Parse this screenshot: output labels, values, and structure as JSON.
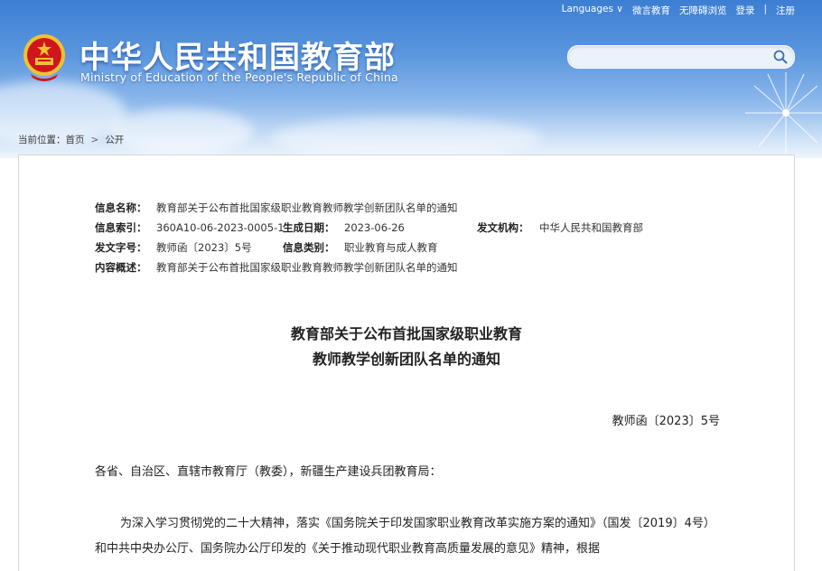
{
  "header": {
    "title_cn": "中华人民共和国教育部",
    "title_en": "Ministry of Education of the People's Republic of China",
    "top_links": {
      "languages": "Languages ∨",
      "weibo": "微言教育",
      "accessibility": "无障碍浏览",
      "login": "登录",
      "divider": "|",
      "register": "注册"
    },
    "search_placeholder": ""
  },
  "breadcrumb": {
    "prefix": "当前位置：",
    "home": "首页",
    "separator": ">",
    "current": "公开"
  },
  "meta": {
    "name_label": "信息名称：",
    "name_value": "教育部关于公布首批国家级职业教育教师教学创新团队名单的通知",
    "index_label": "信息索引：",
    "index_value": "360A10-06-2023-0005-1",
    "date_label": "生成日期：",
    "date_value": "2023-06-26",
    "org_label": "发文机构：",
    "org_value": "中华人民共和国教育部",
    "docno_label": "发文字号：",
    "docno_value": "教师函〔2023〕5号",
    "category_label": "信息类别：",
    "category_value": "职业教育与成人教育",
    "summary_label": "内容概述：",
    "summary_value": "教育部关于公布首批国家级职业教育教师教学创新团队名单的通知"
  },
  "document": {
    "title_line1": "教育部关于公布首批国家级职业教育",
    "title_line2": "教师教学创新团队名单的通知",
    "number": "教师函〔2023〕5号",
    "addressee": "各省、自治区、直辖市教育厅（教委），新疆生产建设兵团教育局：",
    "paragraph1": "为深入学习贯彻党的二十大精神，落实《国务院关于印发国家职业教育改革实施方案的通知》（国发〔2019〕4号）和中共中央办公厅、国务院办公厅印发的《关于推动现代职业教育高质量发展的意见》精神，根据"
  },
  "colors": {
    "header_blue": "#3c7ed2",
    "emblem_red": "#d0161d",
    "emblem_gold": "#f2c230"
  }
}
